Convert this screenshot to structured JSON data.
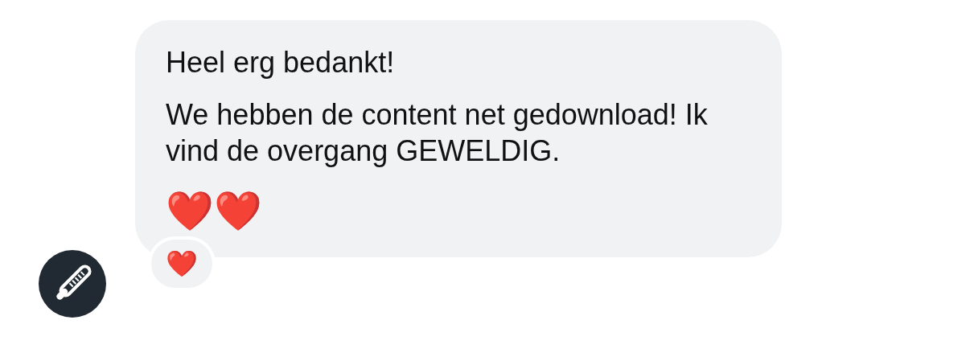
{
  "message": {
    "sender_avatar": {
      "kind": "avatar"
    },
    "paragraphs": [
      "Heel erg bedankt!",
      "We hebben de content net gedownload! Ik vind de overgang GEWELDIG.",
      "❤️❤️"
    ],
    "reactions": [
      "❤️"
    ]
  }
}
